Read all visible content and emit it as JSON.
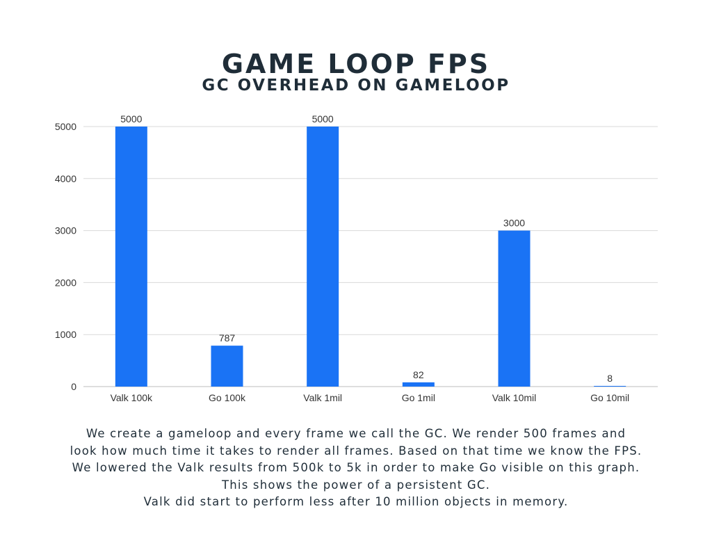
{
  "header": {
    "title": "GAME LOOP FPS",
    "subtitle": "GC OVERHEAD ON GAMELOOP"
  },
  "chart_data": {
    "type": "bar",
    "title": "GAME LOOP FPS",
    "subtitle": "GC OVERHEAD ON GAMELOOP",
    "categories": [
      "Valk 100k",
      "Go 100k",
      "Valk 1mil",
      "Go 1mil",
      "Valk 10mil",
      "Go 10mil"
    ],
    "values": [
      5000,
      787,
      5000,
      82,
      3000,
      8
    ],
    "data_labels": [
      "5000",
      "787",
      "5000",
      "82",
      "3000",
      "8"
    ],
    "yticks": [
      0,
      1000,
      2000,
      3000,
      4000,
      5000
    ],
    "ylim": [
      0,
      5000
    ],
    "xlabel": "",
    "ylabel": "",
    "grid": true,
    "legend": "none",
    "bar_color": "#1a73f5",
    "grid_color": "#d9d9d9",
    "text_color": "#333333"
  },
  "caption": {
    "lines": [
      "We create a gameloop and every frame we call the GC. We render 500 frames and",
      "look how much time it takes to render all frames. Based on that time we know the FPS.",
      "We lowered the Valk results from 500k to 5k in order to make Go visible on this graph.",
      "This shows the power of a persistent GC.",
      "Valk did start to perform less after 10 million objects in memory."
    ]
  }
}
